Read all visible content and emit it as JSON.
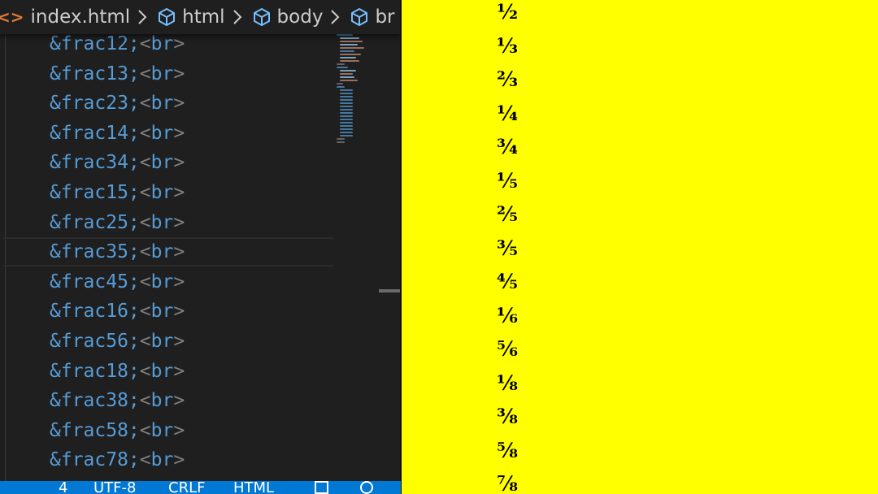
{
  "breadcrumb": {
    "file_icon": "<>",
    "file": "index.html",
    "items": [
      "html",
      "body",
      "br"
    ]
  },
  "code_lines": [
    {
      "entity": "&frac12;",
      "tag": "br"
    },
    {
      "entity": "&frac13;",
      "tag": "br"
    },
    {
      "entity": "&frac23;",
      "tag": "br"
    },
    {
      "entity": "&frac14;",
      "tag": "br"
    },
    {
      "entity": "&frac34;",
      "tag": "br"
    },
    {
      "entity": "&frac15;",
      "tag": "br"
    },
    {
      "entity": "&frac25;",
      "tag": "br"
    },
    {
      "entity": "&frac35;",
      "tag": "br"
    },
    {
      "entity": "&frac45;",
      "tag": "br"
    },
    {
      "entity": "&frac16;",
      "tag": "br"
    },
    {
      "entity": "&frac56;",
      "tag": "br"
    },
    {
      "entity": "&frac18;",
      "tag": "br"
    },
    {
      "entity": "&frac38;",
      "tag": "br"
    },
    {
      "entity": "&frac58;",
      "tag": "br"
    },
    {
      "entity": "&frac78;",
      "tag": "br"
    }
  ],
  "active_line_index": 7,
  "status_bar": {
    "spaces": "4",
    "encoding": "UTF-8",
    "eol": "CRLF",
    "language": "HTML"
  },
  "rendered_fractions": [
    "½",
    "⅓",
    "⅔",
    "¼",
    "¾",
    "⅕",
    "⅖",
    "⅗",
    "⅘",
    "⅙",
    "⅚",
    "⅛",
    "⅜",
    "⅝",
    "⅞"
  ],
  "colors": {
    "editor_bg": "#1f1f1f",
    "entity": "#569cd6",
    "status_bar": "#0078d4",
    "preview_bg": "#ffff00"
  }
}
